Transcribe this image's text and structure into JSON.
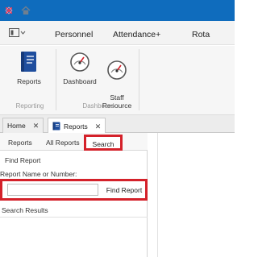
{
  "header": {
    "icons": [
      "app-logo-icon",
      "home-icon"
    ],
    "brand_color": "#0f6cbd"
  },
  "menu": {
    "view_icon": "panel-toggle-icon",
    "items": [
      "Personnel",
      "Attendance+",
      "Rota"
    ]
  },
  "ribbon": {
    "groups": [
      {
        "label": "Reporting",
        "buttons": [
          {
            "label": "Reports",
            "icon": "book-icon"
          }
        ]
      },
      {
        "label": "Dashboard",
        "buttons": [
          {
            "label": "Dashboard",
            "icon": "gauge-icon"
          },
          {
            "label": "Staff\nResource",
            "icon": "gauge-icon"
          }
        ]
      }
    ]
  },
  "doc_tabs": [
    {
      "label": "Home",
      "active": false
    },
    {
      "label": "Reports",
      "active": true,
      "icon": "book-icon"
    }
  ],
  "sub_tabs": {
    "items": [
      "Reports",
      "All Reports",
      "Search"
    ],
    "selected": "Search"
  },
  "search": {
    "section_title": "Find Report",
    "field_label": "Report Name or Number:",
    "input_value": "",
    "button_label": "Find Report",
    "results_title": "Search Results"
  },
  "highlight_color": "#d4212a"
}
